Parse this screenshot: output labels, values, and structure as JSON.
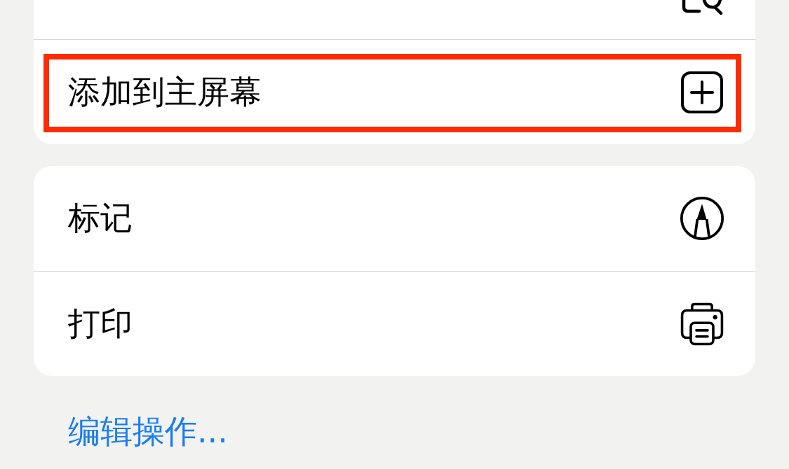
{
  "groups": [
    {
      "items": [
        {
          "kind": "search",
          "highlighted": false
        },
        {
          "label": "添加到主屏幕",
          "kind": "add",
          "highlighted": true
        }
      ]
    },
    {
      "items": [
        {
          "label": "标记",
          "kind": "markup",
          "highlighted": false
        },
        {
          "label": "打印",
          "kind": "print",
          "highlighted": false
        }
      ]
    }
  ],
  "edit_link": "编辑操作..."
}
